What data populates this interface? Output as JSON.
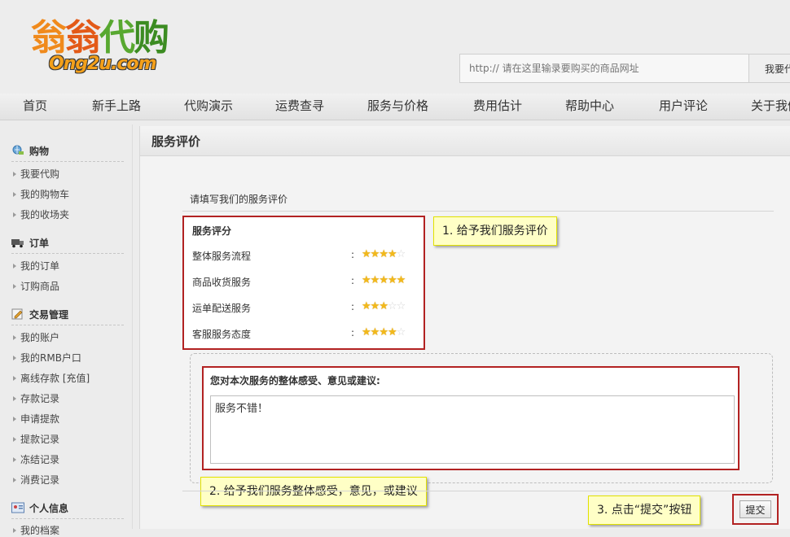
{
  "header": {
    "logo_cn": [
      "翁",
      "翁",
      "代",
      "购"
    ],
    "logo_en": "Ong2u.com",
    "search_placeholder": "http:// 请在这里输录要购买的商品网址",
    "search_button": "我要代购"
  },
  "nav": [
    "首页",
    "新手上路",
    "代购演示",
    "运费查寻",
    "服务与价格",
    "费用估计",
    "帮助中心",
    "用户评论",
    "关于我们"
  ],
  "sidebar": {
    "groups": [
      {
        "title": "购物",
        "icon": "globe-cart-icon",
        "items": [
          "我要代购",
          "我的购物车",
          "我的收场夹"
        ]
      },
      {
        "title": "订单",
        "icon": "truck-icon",
        "items": [
          "我的订单",
          "订购商品"
        ]
      },
      {
        "title": "交易管理",
        "icon": "edit-icon",
        "items": [
          "我的账户",
          "我的RMB户口",
          "离线存款 [充值]",
          "存款记录",
          "申请提款",
          "提款记录",
          "冻结记录",
          "消费记录"
        ]
      },
      {
        "title": "个人信息",
        "icon": "profile-card-icon",
        "items": [
          "我的档案"
        ]
      }
    ]
  },
  "main": {
    "title": "服务评价",
    "intro": "请填写我们的服务评价",
    "rating": {
      "heading": "服务评分",
      "items": [
        {
          "label": "整体服务流程",
          "stars": 4,
          "max": 5
        },
        {
          "label": "商品收货服务",
          "stars": 5,
          "max": 5
        },
        {
          "label": "运单配送服务",
          "stars": 3,
          "max": 5
        },
        {
          "label": "客服服务态度",
          "stars": 4,
          "max": 5
        }
      ],
      "colon": ":"
    },
    "comment": {
      "heading": "您对本次服务的整体感受、意见或建议:",
      "value": "服务不错！"
    },
    "submit_label": "提交"
  },
  "callouts": {
    "c1": "1.  给予我们服务评价",
    "c2": "2.  给予我们服务整体感受，意见，或建议",
    "c3": "3.  点击“提交”按钮"
  },
  "colors": {
    "highlight_border": "#b22222",
    "callout_bg": "#ffffc6",
    "star": "#f2b91b"
  }
}
